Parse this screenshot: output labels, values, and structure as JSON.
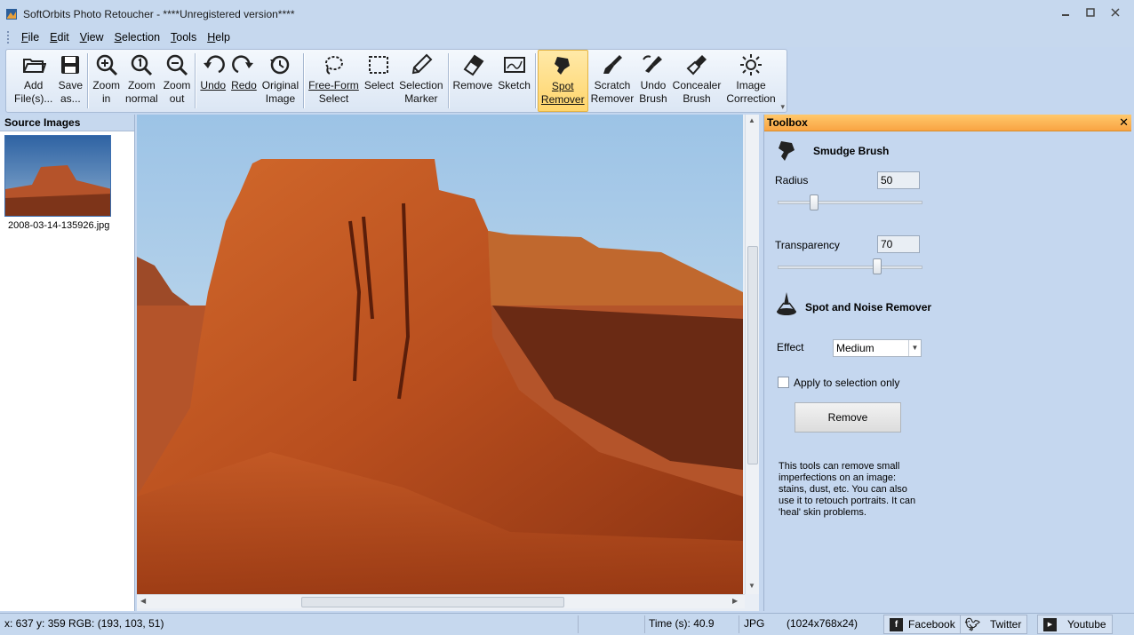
{
  "window": {
    "title": "SoftOrbits Photo Retoucher - ****Unregistered version****"
  },
  "menu": [
    {
      "label": "File",
      "key": "F",
      "rest": "ile"
    },
    {
      "label": "Edit",
      "key": "E",
      "rest": "dit"
    },
    {
      "label": "View",
      "key": "V",
      "rest": "iew"
    },
    {
      "label": "Selection",
      "key": "S",
      "rest": "election"
    },
    {
      "label": "Tools",
      "key": "T",
      "rest": "ools"
    },
    {
      "label": "Help",
      "key": "H",
      "rest": "elp"
    }
  ],
  "toolbar": {
    "add_files": {
      "line1": "Add",
      "line2": "File(s)...",
      "icon": "folder-open-icon"
    },
    "save_as": {
      "line1": "Save",
      "line2": "as...",
      "icon": "floppy-disk-icon"
    },
    "zoom_in": {
      "line1": "Zoom",
      "line2": "in",
      "icon": "zoom-in-icon"
    },
    "zoom_normal": {
      "line1": "Zoom",
      "line2": "normal",
      "icon": "zoom-normal-icon"
    },
    "zoom_out": {
      "line1": "Zoom",
      "line2": "out",
      "icon": "zoom-out-icon"
    },
    "undo": {
      "line1": "Undo",
      "icon": "undo-icon"
    },
    "redo": {
      "line1": "Redo",
      "icon": "redo-icon"
    },
    "original_image": {
      "line1": "Original",
      "line2": "Image",
      "icon": "history-clock-icon"
    },
    "free_form_select": {
      "line1": "Free-Form",
      "line2": "Select",
      "icon": "lasso-icon"
    },
    "select": {
      "line1": "Select",
      "icon": "rect-select-icon"
    },
    "selection_marker": {
      "line1": "Selection",
      "line2": "Marker",
      "icon": "marker-pen-icon"
    },
    "remove": {
      "line1": "Remove",
      "icon": "eraser-icon"
    },
    "sketch": {
      "line1": "Sketch",
      "icon": "sketch-icon"
    },
    "spot_remover": {
      "line1": "Spot",
      "line2": "Remover",
      "icon": "spot-brush-icon"
    },
    "scratch_remover": {
      "line1": "Scratch",
      "line2": "Remover",
      "icon": "scratch-brush-icon"
    },
    "undo_brush": {
      "line1": "Undo",
      "line2": "Brush",
      "icon": "undo-brush-icon"
    },
    "concealer_brush": {
      "line1": "Concealer",
      "line2": "Brush",
      "icon": "concealer-brush-icon"
    },
    "image_correction": {
      "line1": "Image",
      "line2": "Correction",
      "icon": "sun-icon"
    }
  },
  "source_panel": {
    "header": "Source Images",
    "files": [
      {
        "name": "2008-03-14-135926.jpg"
      }
    ]
  },
  "toolbox": {
    "header": "Toolbox",
    "smudge": {
      "title": "Smudge Brush",
      "radius_label": "Radius",
      "radius_value": "50",
      "radius_level_percent": 25,
      "transparency_label": "Transparency",
      "transparency_value": "70",
      "transparency_level_percent": 70
    },
    "spot_noise": {
      "title": "Spot and Noise Remover",
      "effect_label": "Effect",
      "effect_value": "Medium",
      "apply_label": "Apply to selection only",
      "apply_checked": false,
      "remove_button": "Remove",
      "description": "This tools can remove small imperfections on an image: stains, dust, etc. You can also use it to retouch portraits. It can 'heal' skin problems."
    }
  },
  "status": {
    "coords": "x: 637 y: 359  RGB: (193, 103, 51)",
    "time": "Time (s): 40.9",
    "format": "JPG",
    "size": "(1024x768x24)",
    "facebook": "Facebook",
    "twitter": "Twitter",
    "youtube": "Youtube"
  },
  "colors": {
    "accent_orange": "#f9a443",
    "window_bg": "#c5d7ef",
    "facebook": "#3b5998",
    "twitter": "#1da1f2",
    "youtube": "#cc181e"
  }
}
